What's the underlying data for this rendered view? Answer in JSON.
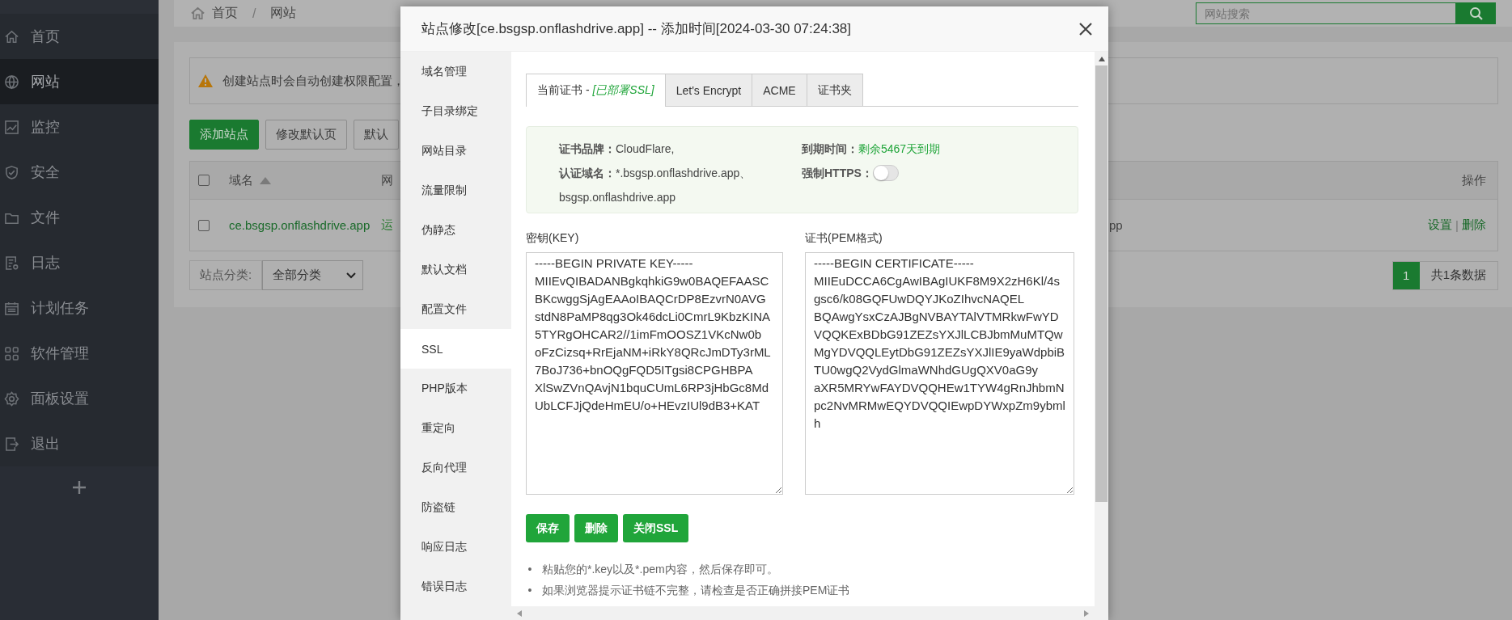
{
  "sidebar": {
    "items": [
      {
        "label": "首页",
        "selected": false
      },
      {
        "label": "网站",
        "selected": true
      },
      {
        "label": "监控",
        "selected": false
      },
      {
        "label": "安全",
        "selected": false
      },
      {
        "label": "文件",
        "selected": false
      },
      {
        "label": "日志",
        "selected": false
      },
      {
        "label": "计划任务",
        "selected": false
      },
      {
        "label": "软件管理",
        "selected": false
      },
      {
        "label": "面板设置",
        "selected": false
      },
      {
        "label": "退出",
        "selected": false
      }
    ]
  },
  "breadcrumb": {
    "items": [
      "首页",
      "网站"
    ],
    "separator": "/"
  },
  "search": {
    "placeholder": "网站搜索"
  },
  "alert": {
    "text": "创建站点时会自动创建权限配置，"
  },
  "toolbar_buttons": [
    {
      "label": "添加站点",
      "primary": true
    },
    {
      "label": "修改默认页",
      "primary": false
    },
    {
      "label": "默认",
      "primary": false
    }
  ],
  "sites_table": {
    "select_all_checked": false,
    "columns": [
      {
        "label": "域名",
        "sorted": true
      },
      {
        "label": "网"
      },
      {
        "label": "操作",
        "sorted": false
      }
    ],
    "rows": [
      {
        "checked": false,
        "domain": "ce.bsgsp.onflashdrive.app",
        "status": "运",
        "column_4": "pp",
        "actions": [
          "设置",
          "删除"
        ],
        "actions_separator": "|"
      }
    ]
  },
  "category_filter": {
    "label": "站点分类:",
    "value": "全部分类"
  },
  "pagination": {
    "pages": [
      {
        "label": "1",
        "selected": true
      }
    ],
    "summary": "共1条数据"
  },
  "dialog": {
    "title": "站点修改[ce.bsgsp.onflashdrive.app] -- 添加时间[2024-03-30 07:24:38]",
    "menu": [
      {
        "label": "域名管理",
        "selected": false
      },
      {
        "label": "子目录绑定",
        "selected": false
      },
      {
        "label": "网站目录",
        "selected": false
      },
      {
        "label": "流量限制",
        "selected": false
      },
      {
        "label": "伪静态",
        "selected": false
      },
      {
        "label": "默认文档",
        "selected": false
      },
      {
        "label": "配置文件",
        "selected": false
      },
      {
        "label": "SSL",
        "selected": true
      },
      {
        "label": "PHP版本",
        "selected": false
      },
      {
        "label": "重定向",
        "selected": false
      },
      {
        "label": "反向代理",
        "selected": false
      },
      {
        "label": "防盗链",
        "selected": false
      },
      {
        "label": "响应日志",
        "selected": false
      },
      {
        "label": "错误日志",
        "selected": false
      }
    ],
    "tabs": [
      {
        "label": "当前证书 - ",
        "status": "[已部署SSL]",
        "selected": true
      },
      {
        "label": "Let's Encrypt",
        "selected": false
      },
      {
        "label": "ACME",
        "selected": false
      },
      {
        "label": "证书夹",
        "selected": false
      }
    ],
    "cert_info": {
      "brand_label": "证书品牌：",
      "brand": "CloudFlare,",
      "domains_label": "认证域名：",
      "domains": "*.bsgsp.onflashdrive.app、bsgsp.onflashdrive.app",
      "expiry_label": "到期时间：",
      "expiry": "剩余5467天到期",
      "force_https_label": "强制HTTPS：",
      "force_https": false
    },
    "key": {
      "label": "密钥(KEY)",
      "value": "-----BEGIN PRIVATE KEY-----\nMIIEvQIBADANBgkqhkiG9w0BAQEFAASCBKcwggSjAgEAAoIBAQCrDP8EzvrN0AVG\nstdN8PaMP8qg3Ok46dcLi0CmrL9KbzKINA5TYRgOHCAR2//1imFmOOSZ1VKcNw0b\noFzCizsq+RrEjaNM+iRkY8QRcJmDTy3rML7BoJ736+bnOQgFQD5ITgsi8CPGHBPA\nXlSwZVnQAvjN1bquCUmL6RP3jHbGc8MdUbLCFJjQdeHmEU/o+HEvzIUl9dB3+KAT"
    },
    "certificate": {
      "label": "证书(PEM格式)",
      "value": "-----BEGIN CERTIFICATE-----\nMIIEuDCCA6CgAwIBAgIUKF8M9X2zH6Kl/4sgsc6/k08GQFUwDQYJKoZIhvcNAQEL\nBQAwgYsxCzAJBgNVBAYTAlVTMRkwFwYDVQQKExBDbG91ZEZsYXJlLCBJbmMuMTQw\nMgYDVQQLEytDbG91ZEZsYXJlIE9yaWdpbiBTU0wgQ2VydGlmaWNhdGUgQXV0aG9y\naXR5MRYwFAYDVQQHEw1TYW4gRnJhbmNpc2NvMRMwEQYDVQQIEwpDYWxpZm9ybmlh"
    },
    "buttons": [
      "保存",
      "删除",
      "关闭SSL"
    ],
    "notes": [
      {
        "bullet": "•",
        "text": "粘贴您的*.key以及*.pem内容，然后保存即可。"
      },
      {
        "bullet": "•",
        "text": "如果浏览器提示证书链不完整，请检查是否正确拼接PEM证书"
      }
    ]
  }
}
